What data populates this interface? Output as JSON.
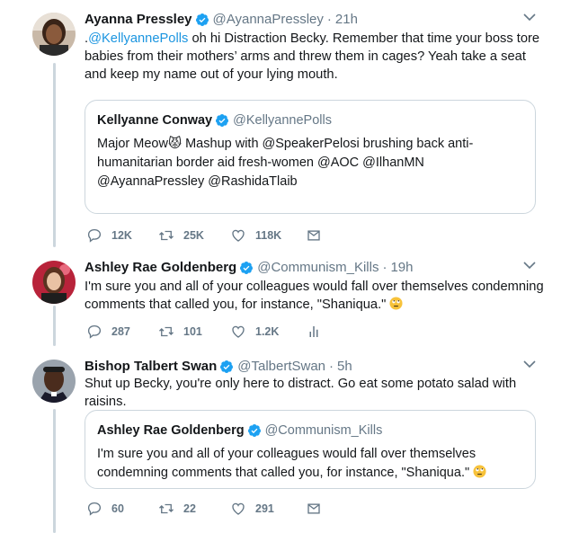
{
  "tweets": [
    {
      "name": "Ayanna Pressley",
      "handle": "@AyannaPressley",
      "time": "21h",
      "text_prefix": ".",
      "text_mention": "@KellyannePolls",
      "text_body": " oh hi Distraction Becky. Remember that time your boss tore babies from their mothers’ arms and threw them in cages? Yeah take a seat and keep my name out of your lying mouth.",
      "quote": {
        "name": "Kellyanne Conway",
        "handle": "@KellyannePolls",
        "text": "Major Meow😾 Mashup with @SpeakerPelosi brushing back anti-humanitarian border aid fresh-women @AOC @IlhanMN @AyannaPressley @RashidaTlaib"
      },
      "replies": "12K",
      "retweets": "25K",
      "likes": "118K"
    },
    {
      "name": "Ashley Rae Goldenberg",
      "handle": "@Communism_Kills",
      "time": "19h",
      "text": "I'm sure you and all of your colleagues would fall over themselves condemning comments that called you, for instance, \"Shaniqua.\"",
      "replies": "287",
      "retweets": "101",
      "likes": "1.2K"
    },
    {
      "name": "Bishop Talbert Swan",
      "handle": "@TalbertSwan",
      "time": "5h",
      "text": "Shut up Becky, you're only here to distract. Go eat some potato salad with raisins.",
      "quote": {
        "name": "Ashley Rae Goldenberg",
        "handle": "@Communism_Kills",
        "text": "I'm sure you and all of your colleagues would fall over themselves condemning comments that called you, for instance, \"Shaniqua.\""
      },
      "replies": "60",
      "retweets": "22",
      "likes": "291"
    }
  ],
  "colors": {
    "link": "#1b95e0",
    "muted": "#657786",
    "verified": "#1da1f2",
    "thread_line": "#ccd6dd"
  },
  "icons": [
    "verified-badge-icon",
    "chevron-down-icon",
    "reply-icon",
    "retweet-icon",
    "like-icon",
    "message-icon",
    "analytics-icon"
  ]
}
